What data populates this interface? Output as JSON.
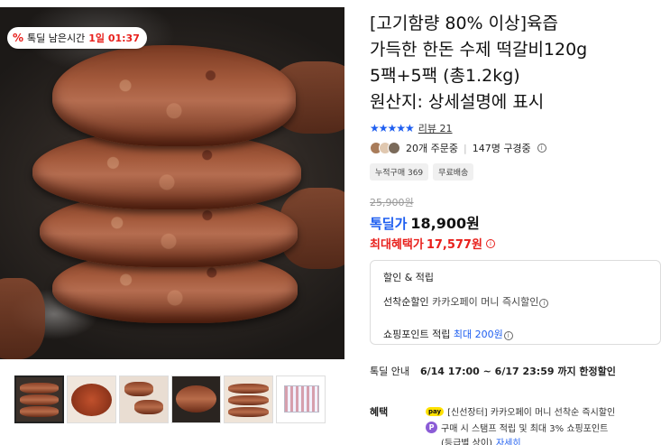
{
  "gallery": {
    "badge": {
      "icon": "percent-icon",
      "label": "톡딜 남은시간",
      "time": "1일 01:37"
    },
    "thumbnails": [
      "thumb-1",
      "thumb-2",
      "thumb-3",
      "thumb-4",
      "thumb-5",
      "thumb-6"
    ]
  },
  "product": {
    "title_lines": [
      "[고기함량 80% 이상]육즙",
      "가득한 한돈 수제 떡갈비120g",
      "5팩+5팩 (총1.2kg)",
      "원산지: 상세설명에 표시"
    ],
    "stars": "★★★★★",
    "review_link": "리뷰 21",
    "orders": "20개 주문중",
    "watchers": "147명 구경중",
    "tags": [
      "누적구매 369",
      "무료배송"
    ],
    "original_price": "25,900원",
    "deal_price_label": "톡딜가",
    "deal_price": "18,900원",
    "max_benefit_label": "최대혜택가",
    "max_benefit_price": "17,577원"
  },
  "discount_box": {
    "title": "할인 & 적립",
    "line1_label": "선착순할인",
    "line1_sub": "카카오페이 머니 즉시할인",
    "line2_label": "쇼핑포인트 적립",
    "line2_value": "최대 200원"
  },
  "deal_notice": {
    "label": "톡딜 안내",
    "text": "6/14 17:00 ~ 6/17 23:59 까지 한정할인"
  },
  "benefit": {
    "label": "혜택",
    "item1_badge": "pay",
    "item1_text": "[신선장터] 카카오페이 머니 선착순 즉시할인",
    "item2_badge": "P",
    "item2_text": "구매 시 스탬프 적립 및 최대 3% 쇼핑포인트",
    "item3_text": "(등급별 상이)",
    "item3_link": "자세히"
  },
  "colors": {
    "accent_blue": "#1e5ef0",
    "accent_red": "#e8201c"
  }
}
